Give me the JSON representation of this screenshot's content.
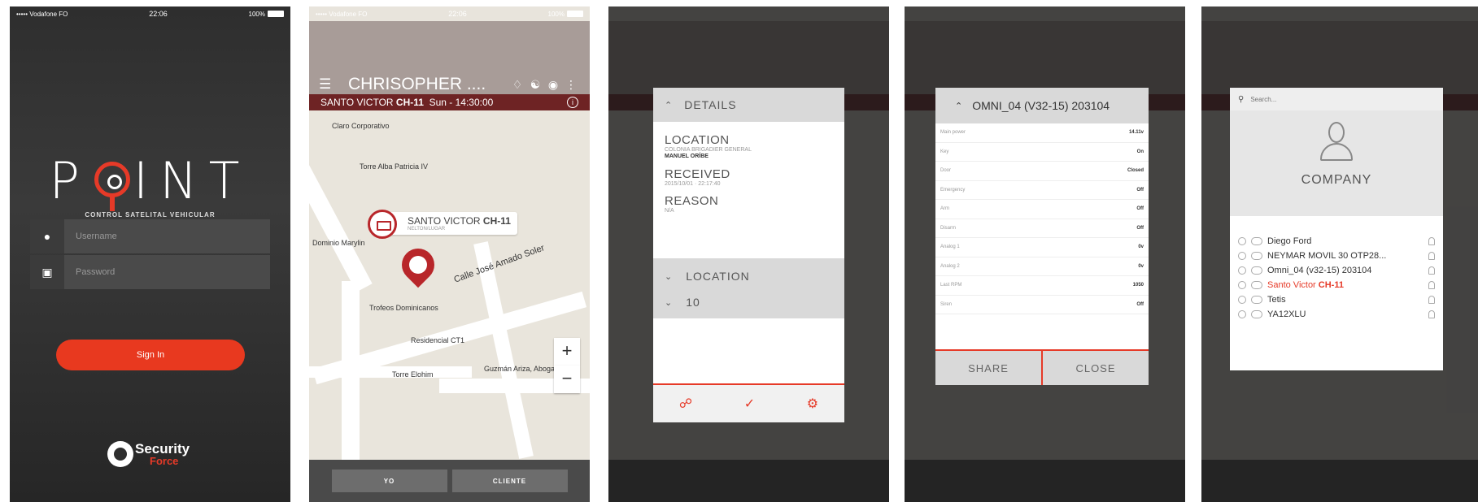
{
  "status": {
    "carrier": "••••• Vodafone FO",
    "time": "22:06",
    "battery": "100%"
  },
  "login": {
    "logo_letters": [
      "P",
      "INT"
    ],
    "tagline": "CONTROL SATELITAL VEHICULAR",
    "username_placeholder": "Username",
    "password_placeholder": "Password",
    "signin_label": "Sign In",
    "brand_line1": "Security",
    "brand_line2": "Force",
    "accent": "#e8391f"
  },
  "app": {
    "title": "CHRISOPHER ....",
    "subbar_name": "SANTO VICTOR",
    "subbar_code": "CH-11",
    "subbar_time": "Sun - 14:30:00",
    "header_color": "#a89c98",
    "subbar_color": "#6e2324"
  },
  "map": {
    "labels": [
      "Claro Corporativo",
      "Torre Alba Patricia IV",
      "Dominio Marylin",
      "Calle José Amado Soler",
      "Trofeos Dominicanos",
      "Residencial CT1",
      "Torre Elohim",
      "Guzmán Ariza, Abogados y..."
    ],
    "callout_name": "SANTO VICTOR",
    "callout_code": "CH-11",
    "callout_sub": "NELTON/LUGAR",
    "zoom_in": "+",
    "zoom_out": "−",
    "btn_yo": "YO",
    "btn_cliente": "CLIENTE"
  },
  "details": {
    "header": "DETAILS",
    "location_label": "LOCATION",
    "location_value": "COLONIA BRIGADIER GENERAL",
    "location_value_bold": "MANUEL ORÍBE",
    "received_label": "RECEIVED",
    "received_value": "2015/10/01 · 22:17:40",
    "reason_label": "REASON",
    "reason_value": "N/A",
    "row_location": "LOCATION",
    "row_ten": "10"
  },
  "omni": {
    "header": "OMNI_04 (V32-15) 203104",
    "rows": [
      {
        "k": "Main power",
        "v": "14.11v"
      },
      {
        "k": "Key",
        "v": "On"
      },
      {
        "k": "Door",
        "v": "Closed"
      },
      {
        "k": "Emergency",
        "v": "Off"
      },
      {
        "k": "Arm",
        "v": "Off"
      },
      {
        "k": "Disarm",
        "v": "Off"
      },
      {
        "k": "Analog 1",
        "v": "0v"
      },
      {
        "k": "Analog 2",
        "v": "0v"
      },
      {
        "k": "Last RPM",
        "v": "1050"
      },
      {
        "k": "Siren",
        "v": "Off"
      }
    ],
    "share": "SHARE",
    "close": "CLOSE"
  },
  "company": {
    "search_placeholder": "Search...",
    "title": "COMPANY",
    "items": [
      {
        "name": "Diego Ford",
        "code": ""
      },
      {
        "name": "NEYMAR MOVIL 30 OTP28...",
        "code": ""
      },
      {
        "name": "Omni_04 (v32-15) 203104",
        "code": ""
      },
      {
        "name": "Santo Victor",
        "code": "CH-11"
      },
      {
        "name": "Tetis",
        "code": ""
      },
      {
        "name": "YA12XLU",
        "code": ""
      }
    ]
  }
}
